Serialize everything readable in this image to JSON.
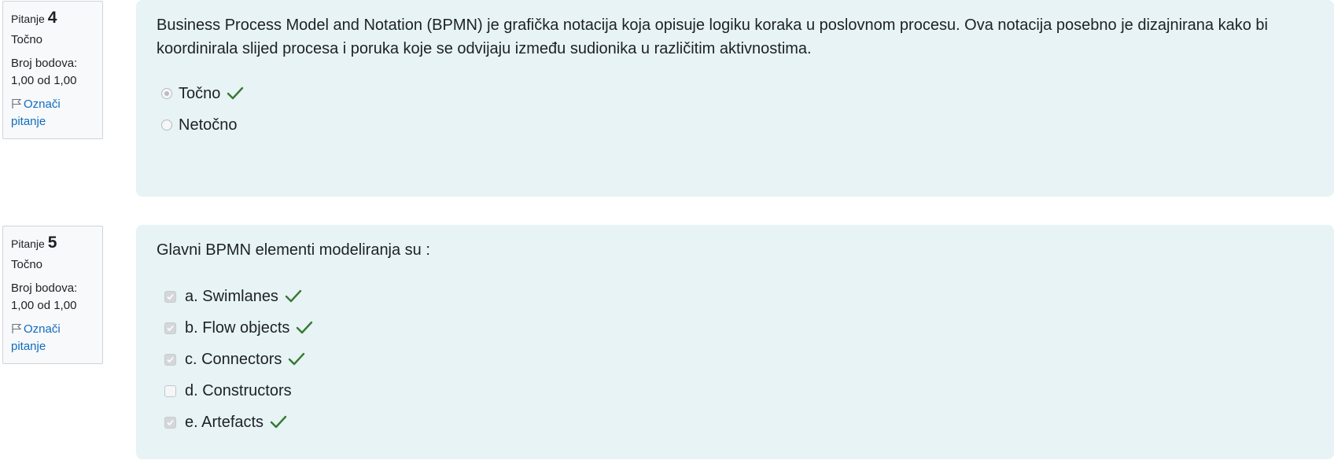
{
  "questions": [
    {
      "label": "Pitanje",
      "number": "4",
      "state": "Točno",
      "grade_label": "Broj bodova:",
      "grade_value": "1,00 od 1,00",
      "flag_line1": "Označi",
      "flag_line2": "pitanje",
      "text": "Business Process Model and Notation (BPMN) je grafička notacija koja opisuje logiku koraka u poslovnom procesu. Ova notacija posebno je dizajnirana kako bi koordinirala slijed procesa i poruka koje se odvijaju između sudionika u različitim aktivnostima.",
      "answers": [
        {
          "label": "Točno",
          "selected": true,
          "correct": true
        },
        {
          "label": "Netočno",
          "selected": false,
          "correct": false
        }
      ]
    },
    {
      "label": "Pitanje",
      "number": "5",
      "state": "Točno",
      "grade_label": "Broj bodova:",
      "grade_value": "1,00 od 1,00",
      "flag_line1": "Označi",
      "flag_line2": "pitanje",
      "text": "Glavni BPMN elementi modeliranja su :",
      "answers": [
        {
          "label": "a. Swimlanes",
          "selected": true,
          "correct": true
        },
        {
          "label": "b. Flow objects",
          "selected": true,
          "correct": true
        },
        {
          "label": "c. Connectors",
          "selected": true,
          "correct": true
        },
        {
          "label": "d. Constructors",
          "selected": false,
          "correct": false
        },
        {
          "label": "e. Artefacts",
          "selected": true,
          "correct": true
        }
      ]
    }
  ],
  "colors": {
    "accent": "#0f6cbf",
    "correct": "#357a32",
    "content_bg": "#e7f3f5"
  },
  "icons": {
    "flag": "flag-icon",
    "correct": "check-icon"
  }
}
